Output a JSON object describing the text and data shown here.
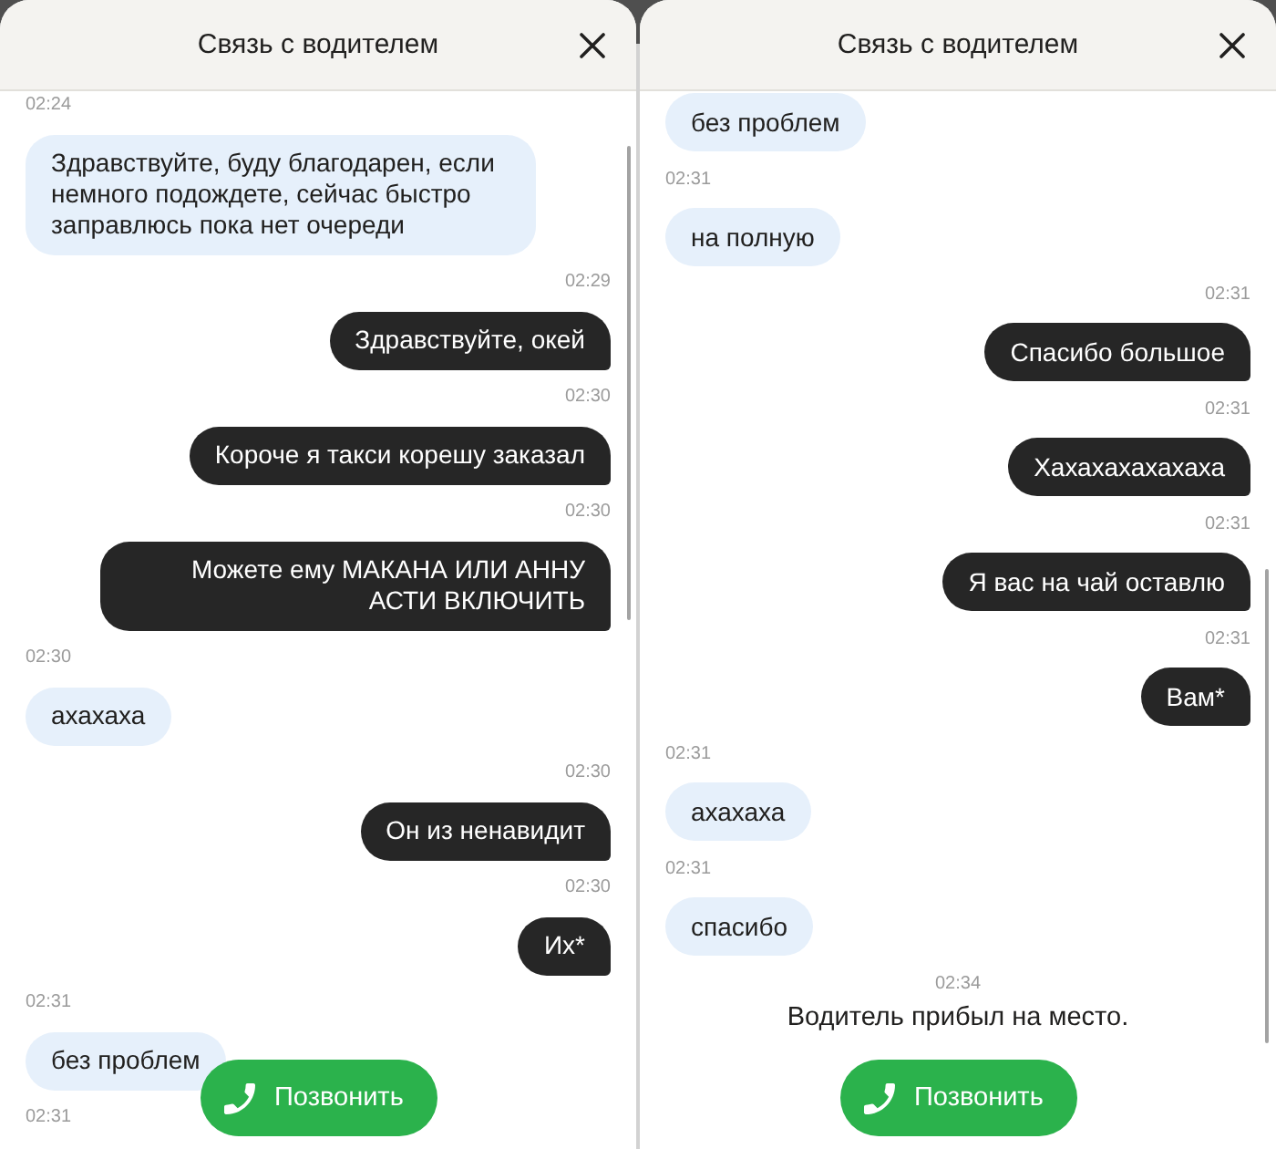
{
  "panels": [
    {
      "header": {
        "title": "Связь с водителем"
      },
      "messages": [
        {
          "kind": "time",
          "outgoing": false,
          "text": "02:24"
        },
        {
          "kind": "bubble",
          "outgoing": false,
          "text": "Здравствуйте, буду благодарен, если немного подождете, сейчас быстро заправлюсь пока нет очереди"
        },
        {
          "kind": "time",
          "outgoing": true,
          "text": "02:29"
        },
        {
          "kind": "bubble",
          "outgoing": true,
          "text": "Здравствуйте, окей"
        },
        {
          "kind": "time",
          "outgoing": true,
          "text": "02:30"
        },
        {
          "kind": "bubble",
          "outgoing": true,
          "text": "Короче я такси корешу заказал"
        },
        {
          "kind": "time",
          "outgoing": true,
          "text": "02:30"
        },
        {
          "kind": "bubble",
          "outgoing": true,
          "text": "Можете ему МАКАНА ИЛИ АННУ АСТИ ВКЛЮЧИТЬ"
        },
        {
          "kind": "time",
          "outgoing": false,
          "text": "02:30"
        },
        {
          "kind": "bubble",
          "outgoing": false,
          "text": "ахахаха"
        },
        {
          "kind": "time",
          "outgoing": true,
          "text": "02:30"
        },
        {
          "kind": "bubble",
          "outgoing": true,
          "text": "Он из ненавидит"
        },
        {
          "kind": "time",
          "outgoing": true,
          "text": "02:30"
        },
        {
          "kind": "bubble",
          "outgoing": true,
          "text": "Их*"
        },
        {
          "kind": "time",
          "outgoing": false,
          "text": "02:31"
        },
        {
          "kind": "bubble",
          "outgoing": false,
          "text": "без проблем"
        },
        {
          "kind": "time",
          "outgoing": false,
          "text": "02:31"
        }
      ],
      "call_button": {
        "label": "Позвонить"
      }
    },
    {
      "header": {
        "title": "Связь с водителем"
      },
      "messages": [
        {
          "kind": "bubble",
          "outgoing": false,
          "text": "без проблем"
        },
        {
          "kind": "time",
          "outgoing": false,
          "text": "02:31"
        },
        {
          "kind": "bubble",
          "outgoing": false,
          "text": "на полную"
        },
        {
          "kind": "time",
          "outgoing": true,
          "text": "02:31"
        },
        {
          "kind": "bubble",
          "outgoing": true,
          "text": "Спасибо большое"
        },
        {
          "kind": "time",
          "outgoing": true,
          "text": "02:31"
        },
        {
          "kind": "bubble",
          "outgoing": true,
          "text": "Хахахахахахаха"
        },
        {
          "kind": "time",
          "outgoing": true,
          "text": "02:31"
        },
        {
          "kind": "bubble",
          "outgoing": true,
          "text": "Я вас на чай оставлю"
        },
        {
          "kind": "time",
          "outgoing": true,
          "text": "02:31"
        },
        {
          "kind": "bubble",
          "outgoing": true,
          "text": "Вам*"
        },
        {
          "kind": "time",
          "outgoing": false,
          "text": "02:31"
        },
        {
          "kind": "bubble",
          "outgoing": false,
          "text": "ахахаха"
        },
        {
          "kind": "time",
          "outgoing": false,
          "text": "02:31"
        },
        {
          "kind": "bubble",
          "outgoing": false,
          "text": "спасибо"
        },
        {
          "kind": "notice",
          "time": "02:34",
          "text": "Водитель прибыл на место."
        }
      ],
      "call_button": {
        "label": "Позвонить"
      }
    }
  ]
}
